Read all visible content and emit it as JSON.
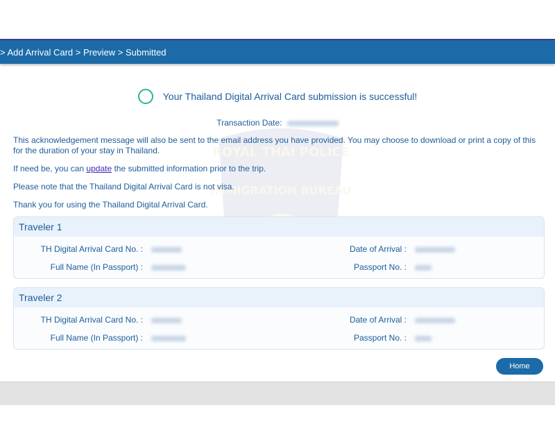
{
  "breadcrumb": {
    "text": "> Add Arrival Card > Preview > Submitted"
  },
  "success": {
    "message": "Your Thailand Digital Arrival Card submission is successful!"
  },
  "transaction": {
    "label": "Transaction Date:"
  },
  "paragraphs": {
    "acknowledgement": "This acknowledgement message will also be sent to the email address you have provided. You may choose to download or print a copy of this for the duration of your stay in Thailand.",
    "update_prefix": "If need be, you can ",
    "update_link": "update",
    "update_suffix": " the submitted information prior to the trip.",
    "not_visa": "Please note that the Thailand Digital Arrival Card is not visa.",
    "thanks": "Thank you for using the Thailand Digital Arrival Card."
  },
  "watermark": {
    "line1": "ROYAL THAI POLICE",
    "line2": "IMMIGRATION BUREAU"
  },
  "travelers": [
    {
      "title": "Traveler 1",
      "card_no_label": "TH Digital Arrival Card No. :",
      "name_label": "Full Name (In Passport) :",
      "arrival_label": "Date of Arrival :",
      "passport_label": "Passport No. :"
    },
    {
      "title": "Traveler 2",
      "card_no_label": "TH Digital Arrival Card No. :",
      "name_label": "Full Name (In Passport) :",
      "arrival_label": "Date of Arrival :",
      "passport_label": "Passport No. :"
    }
  ],
  "home_button": {
    "label": "Home"
  },
  "colors": {
    "primary": "#1c6ba8",
    "text": "#1c5c99",
    "success": "#2bb39a",
    "link": "#3a2bb0"
  }
}
